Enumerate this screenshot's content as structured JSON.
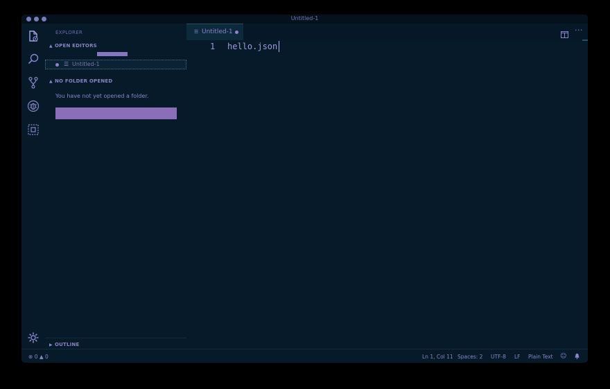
{
  "window": {
    "title": "Untitled-1"
  },
  "activity_bar": {
    "items": [
      "files-icon",
      "search-icon",
      "source-control-icon",
      "debug-icon",
      "extensions-icon"
    ],
    "bottom": "gear-icon"
  },
  "sidebar": {
    "header": "EXPLORER",
    "open_editors": {
      "title": "OPEN EDITORS",
      "files": [
        {
          "name": "Untitled-1",
          "dirty": true
        }
      ]
    },
    "no_folder": {
      "title": "NO FOLDER OPENED",
      "message": "You have not yet opened a folder.",
      "button_label": ""
    },
    "outline_title": "OUTLINE"
  },
  "editor": {
    "tab": {
      "label": "Untitled-1",
      "dirty": true
    },
    "more_label": "···",
    "lines": [
      {
        "number": "1",
        "text": "hello.json"
      }
    ]
  },
  "status_bar": {
    "errors": "0",
    "warnings": "0",
    "position": "Ln 1, Col 11",
    "spaces": "Spaces: 2",
    "encoding": "UTF-8",
    "eol": "LF",
    "language": "Plain Text"
  },
  "colors": {
    "background": "#061a2a",
    "accent": "#8a86c9",
    "button": "#8a6fb8"
  }
}
